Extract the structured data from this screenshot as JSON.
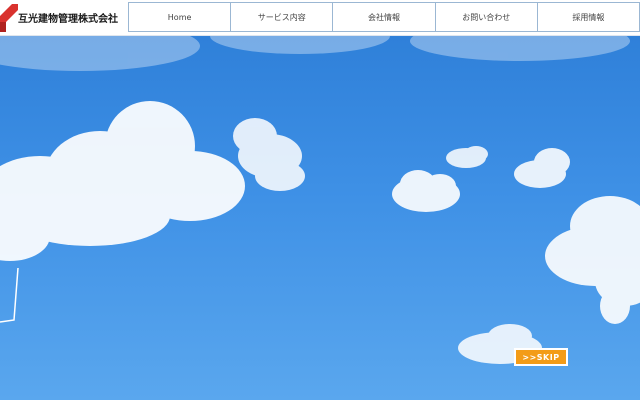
{
  "header": {
    "logo_text": "互光建物管理株式会社",
    "logo_accent": "#d9322e"
  },
  "nav": {
    "items": [
      {
        "label": "Home"
      },
      {
        "label": "サービス内容"
      },
      {
        "label": "会社情報"
      },
      {
        "label": "お問い合わせ"
      },
      {
        "label": "採用情報"
      }
    ]
  },
  "hero": {
    "skip_label": ">>SKIP",
    "skip_color": "#f39c18",
    "sky_color": "#3f91e6"
  }
}
